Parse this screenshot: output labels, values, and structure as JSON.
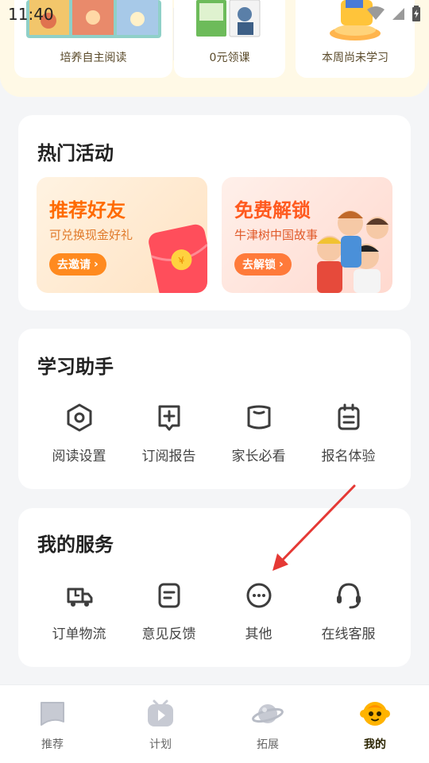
{
  "status_bar": {
    "time": "11:40"
  },
  "top_cards": [
    {
      "label": "培养自主阅读"
    },
    {
      "label": "0元领课"
    },
    {
      "label": "本周尚未学习"
    }
  ],
  "activities": {
    "title": "热门活动",
    "items": [
      {
        "title": "推荐好友",
        "subtitle": "可兑换现金好礼",
        "button": "去邀请"
      },
      {
        "title": "免费解锁",
        "subtitle": "牛津树中国故事",
        "button": "去解锁"
      }
    ]
  },
  "assistant": {
    "title": "学习助手",
    "items": [
      {
        "label": "阅读设置",
        "icon": "hexagon-settings-icon"
      },
      {
        "label": "订阅报告",
        "icon": "report-icon"
      },
      {
        "label": "家长必看",
        "icon": "book-icon"
      },
      {
        "label": "报名体验",
        "icon": "calendar-icon"
      }
    ]
  },
  "services": {
    "title": "我的服务",
    "items": [
      {
        "label": "订单物流",
        "icon": "truck-icon"
      },
      {
        "label": "意见反馈",
        "icon": "feedback-icon"
      },
      {
        "label": "其他",
        "icon": "more-icon"
      },
      {
        "label": "在线客服",
        "icon": "headset-icon"
      }
    ]
  },
  "bottom_nav": [
    {
      "label": "推荐",
      "icon": "recommend-icon"
    },
    {
      "label": "计划",
      "icon": "plan-icon"
    },
    {
      "label": "拓展",
      "icon": "planet-icon"
    },
    {
      "label": "我的",
      "icon": "profile-icon",
      "active": true
    }
  ],
  "colors": {
    "accent_orange": "#ff6a00",
    "promo1_bg": "#ffe9cf",
    "promo2_bg": "#ffe3dc",
    "arrow_red": "#e53935"
  }
}
